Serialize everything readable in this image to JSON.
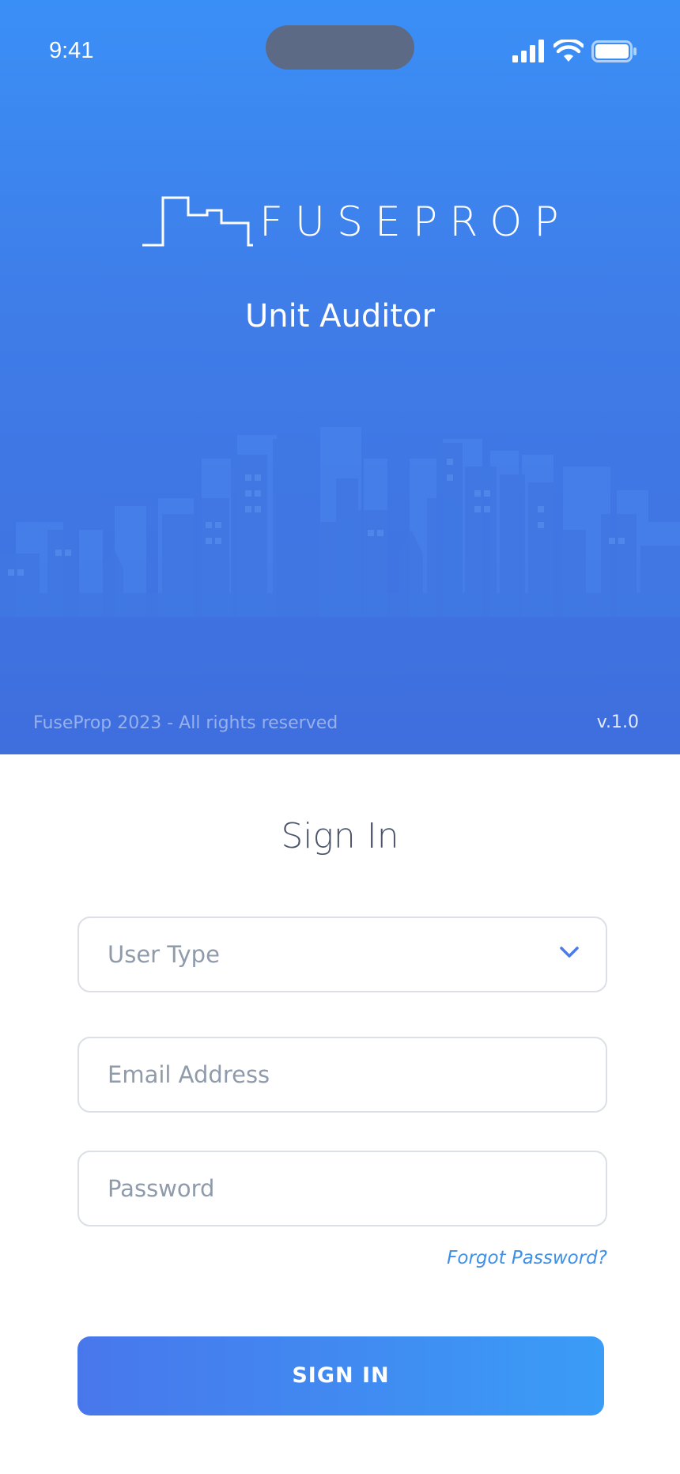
{
  "status_bar": {
    "time": "9:41",
    "icons": [
      "signal-icon",
      "wifi-icon",
      "battery-icon"
    ]
  },
  "brand": {
    "logo_text": "FUSEPROP",
    "app_name": "Unit Auditor",
    "copyright": "FuseProp 2023 - All rights reserved",
    "version": "v.1.0"
  },
  "form": {
    "title": "Sign In",
    "user_type_placeholder": "User Type",
    "email_placeholder": "Email Address",
    "password_placeholder": "Password",
    "forgot_label": "Forgot Password?",
    "submit_label": "SIGN IN"
  },
  "colors": {
    "hero_top": "#3a8ff6",
    "hero_bottom": "#3f6edd",
    "accent": "#3f8fe6",
    "button_start": "#4877ec",
    "button_end": "#3a9cf6"
  }
}
